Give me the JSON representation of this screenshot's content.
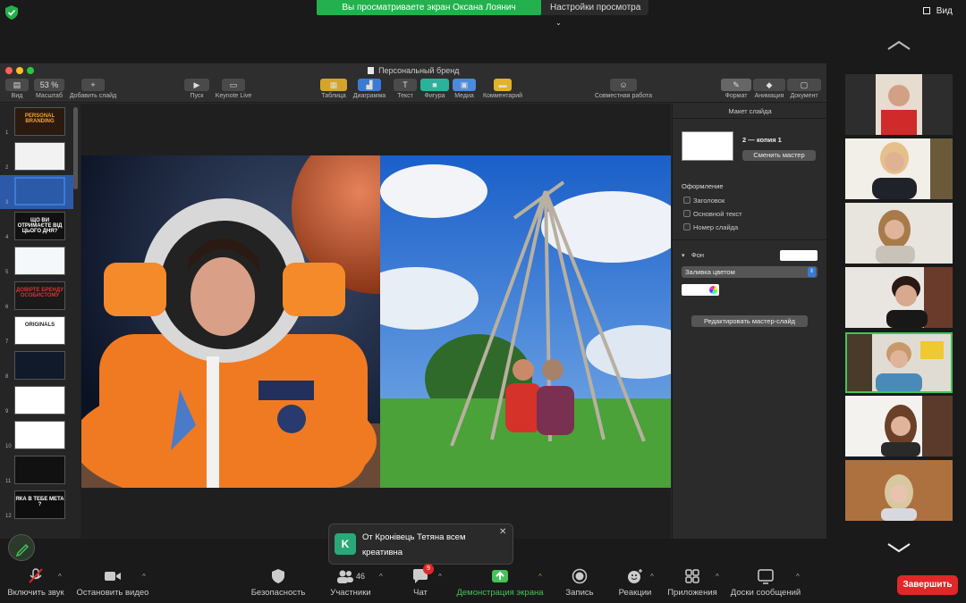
{
  "top_bar": {
    "share_banner": "Вы просматриваете экран Оксана Лоянич",
    "view_settings": "Настройки просмотра",
    "view_button": "Вид"
  },
  "keynote": {
    "window_title": "Персональный бренд",
    "toolbar": {
      "view": "Вид",
      "zoom_value": "53 %",
      "zoom": "Масштаб",
      "add_slide": "Добавить слайд",
      "play": "Пуск",
      "keynote_live": "Keynote Live",
      "table": "Таблица",
      "chart": "Диаграмма",
      "text": "Текст",
      "shape": "Фигура",
      "media": "Медиа",
      "comment": "Комментарий",
      "collaborate": "Совместная работа",
      "format": "Формат",
      "animate": "Анимация",
      "document": "Документ"
    },
    "slides": [
      {
        "num": "1",
        "label": "PERSONAL BRANDING"
      },
      {
        "num": "2",
        "label": ""
      },
      {
        "num": "3",
        "label": ""
      },
      {
        "num": "4",
        "label": "ЩО ВИ ОТРИМАЄТЕ ВІД ЦЬОГО ДНЯ?"
      },
      {
        "num": "5",
        "label": ""
      },
      {
        "num": "6",
        "label": "ДОВІРТЕ БРЕНДУ ОСОБИСТОМУ"
      },
      {
        "num": "7",
        "label": "ORIGINALS"
      },
      {
        "num": "8",
        "label": ""
      },
      {
        "num": "9",
        "label": ""
      },
      {
        "num": "10",
        "label": ""
      },
      {
        "num": "11",
        "label": ""
      },
      {
        "num": "12",
        "label": "ЯКА В ТЕБЕ МЕТА ?"
      }
    ],
    "inspector": {
      "header": "Макет слайда",
      "layout_name": "2 — копия 1",
      "change_master": "Сменить мастер",
      "appearance": "Оформление",
      "title_opt": "Заголовок",
      "body_opt": "Основной текст",
      "slide_number_opt": "Номер слайда",
      "background": "Фон",
      "fill_type": "Заливка цветом",
      "edit_master": "Редактировать мастер-слайд"
    }
  },
  "notification": {
    "avatar_letter": "K",
    "text": "От Кронівець Тетяна всем креативна"
  },
  "bottom_bar": {
    "unmute": "Включить звук",
    "stop_video": "Остановить видео",
    "security": "Безопасность",
    "participants": "Участники",
    "participants_count": "46",
    "chat": "Чат",
    "chat_badge": "9",
    "share_screen": "Демонстрация экрана",
    "record": "Запись",
    "reactions": "Реакции",
    "apps": "Приложения",
    "whiteboards": "Доски сообщений",
    "end": "Завершить"
  },
  "colors": {
    "accent_green": "#22b14c",
    "end_red": "#e02828",
    "active_tile": "#43c35a"
  }
}
